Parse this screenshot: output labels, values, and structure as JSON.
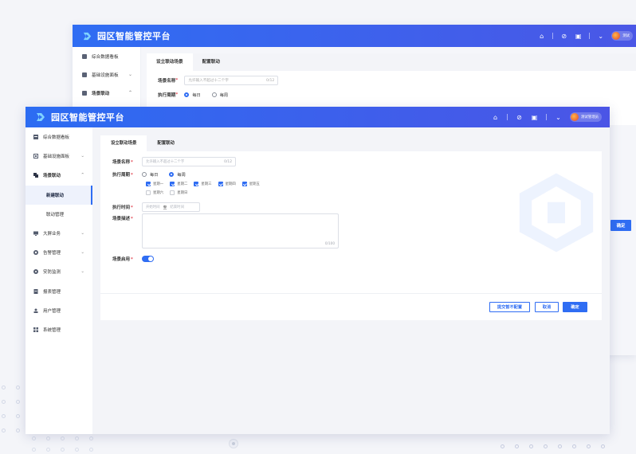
{
  "app": {
    "title": "园区智能管控平台"
  },
  "back": {
    "menu": [
      {
        "label": "综合数据看板",
        "icon": "dashboard-icon",
        "chevron": ""
      },
      {
        "label": "基础设施面板",
        "icon": "panel-icon",
        "chevron": "⌄"
      },
      {
        "label": "场景联动",
        "icon": "linkage-icon",
        "chevron": "⌃"
      }
    ],
    "tabs": [
      "设立联动场景",
      "配置联动"
    ],
    "scene_name_label": "场景名称",
    "scene_name_placeholder": "允许输入不超过十二个字",
    "scene_name_count": "0/12",
    "cycle_label": "执行周期",
    "cycle_daily": "每日",
    "cycle_weekly": "每周",
    "confirm": "确定",
    "user_name": "测试"
  },
  "header": {
    "user_name": "测试管理员"
  },
  "sidebar": {
    "items": [
      {
        "label": "综合数据看板",
        "icon": "dashboard-icon",
        "chevron": ""
      },
      {
        "label": "基础设施面板",
        "icon": "panel-icon",
        "chevron": "⌄"
      },
      {
        "label": "场景联动",
        "icon": "linkage-icon",
        "chevron": "⌃"
      },
      {
        "label": "新建联动",
        "sub": true,
        "active": true
      },
      {
        "label": "联动管理",
        "sub": true
      },
      {
        "label": "大屏业务",
        "icon": "screen-icon",
        "chevron": "⌄"
      },
      {
        "label": "告警管理",
        "icon": "alarm-icon",
        "chevron": "⌄"
      },
      {
        "label": "安防监测",
        "icon": "security-icon",
        "chevron": "⌄"
      },
      {
        "label": "报表管理",
        "icon": "report-icon",
        "chevron": ""
      },
      {
        "label": "用户管理",
        "icon": "user-icon",
        "chevron": ""
      },
      {
        "label": "系统管理",
        "icon": "system-icon",
        "chevron": ""
      }
    ]
  },
  "form": {
    "tabs": [
      "设立联动场景",
      "配置联动"
    ],
    "scene_name": {
      "label": "场景名称",
      "placeholder": "允许输入不超过十二个字",
      "count": "0/12"
    },
    "cycle": {
      "label": "执行周期",
      "daily": "每日",
      "weekly": "每周",
      "selected": "每周"
    },
    "weekdays": [
      {
        "label": "星期一",
        "checked": true
      },
      {
        "label": "星期二",
        "checked": true
      },
      {
        "label": "星期三",
        "checked": true
      },
      {
        "label": "星期四",
        "checked": true
      },
      {
        "label": "星期五",
        "checked": true
      },
      {
        "label": "星期六",
        "checked": false
      },
      {
        "label": "星期日",
        "checked": false
      }
    ],
    "exec_time": {
      "label": "执行时间",
      "start": "开始时间",
      "to": "至",
      "end": "结束时间"
    },
    "description": {
      "label": "场景描述",
      "count": "0/100"
    },
    "enabled": {
      "label": "场景启用",
      "value": true
    },
    "buttons": {
      "submit_no_config": "提交暂不配置",
      "cancel": "取消",
      "confirm": "确定"
    }
  },
  "colors": {
    "primary": "#2f6df3",
    "header_end": "#4b55e6",
    "required": "#e34d59"
  }
}
